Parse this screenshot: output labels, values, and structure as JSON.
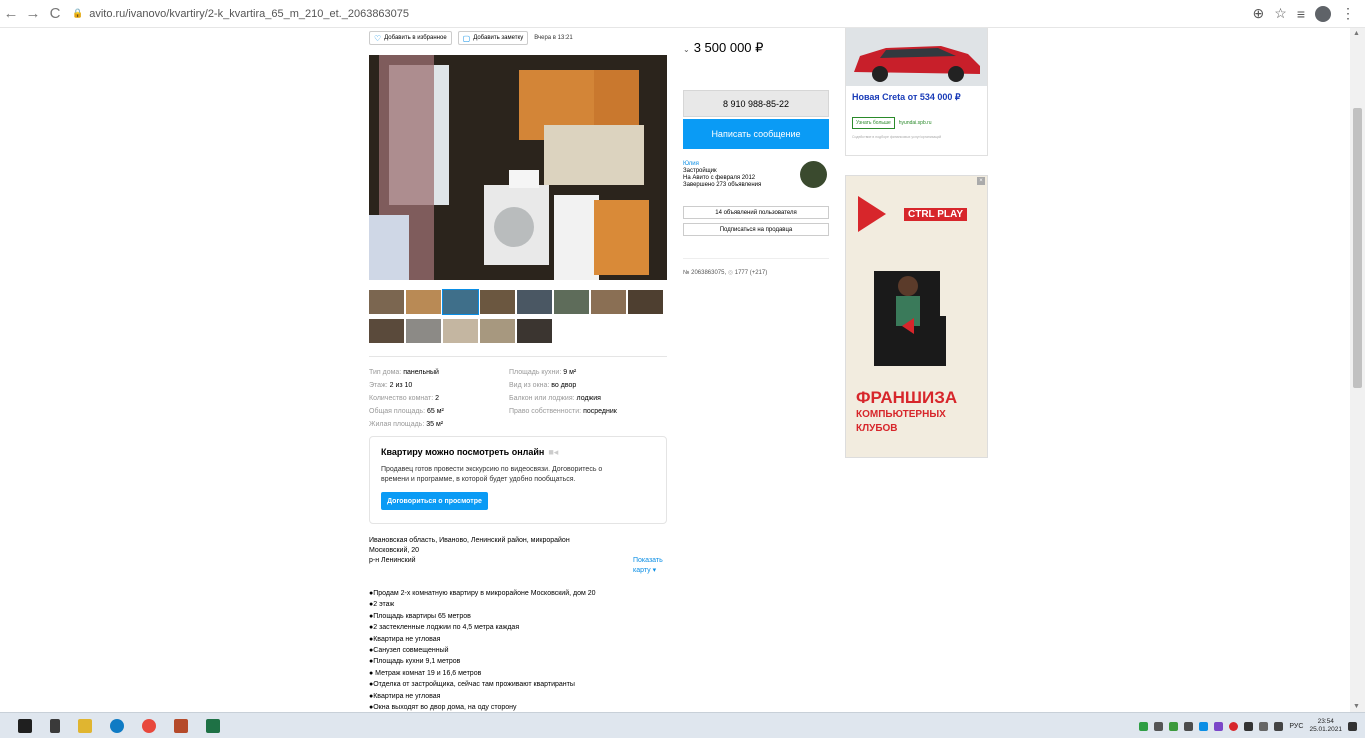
{
  "browser": {
    "url": "avito.ru/ivanovo/kvartiry/2-k_kvartira_65_m_210_et._2063863075"
  },
  "listing": {
    "add_favorite_label": "Добавить в избранное",
    "add_note_label": "Добавить заметку",
    "date": "Вчера в 13:21",
    "price": "3 500 000 ₽",
    "params": [
      {
        "label": "Тип дома:",
        "value": "панельный",
        "label2": "Площадь кухни:",
        "value2": "9 м²"
      },
      {
        "label": "Этаж:",
        "value": "2 из 10",
        "label2": "Вид из окна:",
        "value2": "во двор"
      },
      {
        "label": "Количество комнат:",
        "value": "2",
        "label2": "Балкон или лоджия:",
        "value2": "лоджия"
      },
      {
        "label": "Общая площадь:",
        "value": "65 м²",
        "label2": "Право собственности:",
        "value2": "посредник"
      },
      {
        "label": "Жилая площадь:",
        "value": "35 м²",
        "label2": "",
        "value2": ""
      }
    ],
    "tour": {
      "title": "Квартиру можно посмотреть онлайн",
      "description": "Продавец готов провести экскурсию по видеосвязи. Договоритесь о времени и программе, в которой будет удобно пообщаться.",
      "button": "Договориться о просмотре"
    },
    "address": {
      "line1": "Ивановская область, Иваново, Ленинский район, микрорайон",
      "line2": "Московский, 20",
      "district": "р-н Ленинский",
      "map_link": "Показать карту"
    },
    "description": [
      "●Продам 2-х комнатную квартиру в микрорайоне Московский, дом 20",
      "●2 этаж",
      "●Площадь квартиры 65 метров",
      "●2 застекленные лоджии по 4,5 метра каждая",
      "●Квартира не угловая",
      "●Санузел совмещенный",
      "●Площадь кухни 9,1 метров",
      "● Метраж комнат 19 и 16,6 метров",
      "●Отделка от застройщика, сейчас там проживают квартиранты",
      "●Квартира не угловая",
      "●Окна выходят во двор дома, на оду сторону"
    ]
  },
  "contact": {
    "phone": "8 910 988-85-22",
    "message_button": "Написать сообщение",
    "seller_name": "Юлия",
    "seller_type": "Застройщик",
    "seller_since": "На Авито с февраля 2012",
    "seller_done": "Завершено 273 объявления",
    "user_ads_button": "14 объявлений пользователя",
    "subscribe_button": "Подписаться на продавца",
    "ad_number": "№ 2063863075,",
    "views": "1777 (+217)"
  },
  "ads": {
    "car_title": "Новая Creta от 534 000 ₽",
    "car_more": "Узнать больше",
    "car_site": "hyundai.spb.ru",
    "car_disclaimer": "Содействие в подборе финансовых услуг/организаций",
    "ctrl_logo": "CTRL PLAY",
    "ctrl_big": "ФРАНШИЗА",
    "ctrl_sub": "КОМПЬЮТЕРНЫХ КЛУБОВ"
  },
  "taskbar": {
    "lang": "РУС",
    "time": "23:54",
    "date": "25.01.2021"
  },
  "colors": {
    "accent": "#0a9bf5",
    "link": "#0a8ee5",
    "ad_red": "#d7262b"
  }
}
